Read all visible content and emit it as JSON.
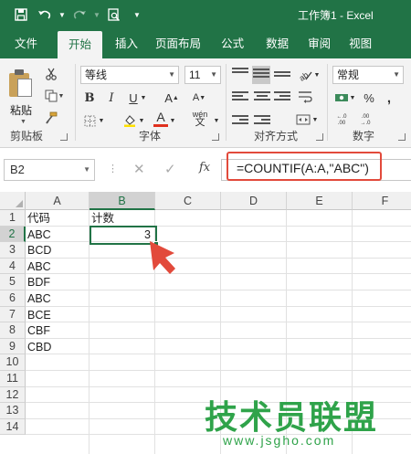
{
  "window": {
    "title": "工作簿1  -  Excel"
  },
  "tabs": [
    "文件",
    "开始",
    "插入",
    "页面布局",
    "公式",
    "数据",
    "审阅",
    "视图"
  ],
  "ribbon": {
    "clipboard": {
      "label": "剪贴板",
      "paste": "粘贴"
    },
    "font": {
      "label": "字体",
      "name": "等线",
      "size": "11",
      "phonetic": "wén"
    },
    "alignment": {
      "label": "对齐方式"
    },
    "number": {
      "label": "数字",
      "format": "常规"
    }
  },
  "formula_bar": {
    "name_box": "B2",
    "fx": "fx",
    "formula": "=COUNTIF(A:A,\"ABC\")"
  },
  "sheet": {
    "columns": [
      "A",
      "B",
      "C",
      "D",
      "E",
      "F"
    ],
    "rows": [
      "1",
      "2",
      "3",
      "4",
      "5",
      "6",
      "7",
      "8",
      "9",
      "10",
      "11",
      "12",
      "13",
      "14"
    ],
    "active_cell": "B2",
    "cells": {
      "A1": "代码",
      "B1": "计数",
      "A2": "ABC",
      "B2": "3",
      "A3": "BCD",
      "A4": "ABC",
      "A5": "BDF",
      "A6": "ABC",
      "A7": "BCE",
      "A8": "CBF",
      "A9": "CBD"
    }
  },
  "watermark": {
    "text": "技术员联盟",
    "url": "www.jsgho.com"
  },
  "colors": {
    "excel_green": "#217346",
    "highlight_red": "#e24a3b",
    "watermark_green": "#2fa34a"
  }
}
